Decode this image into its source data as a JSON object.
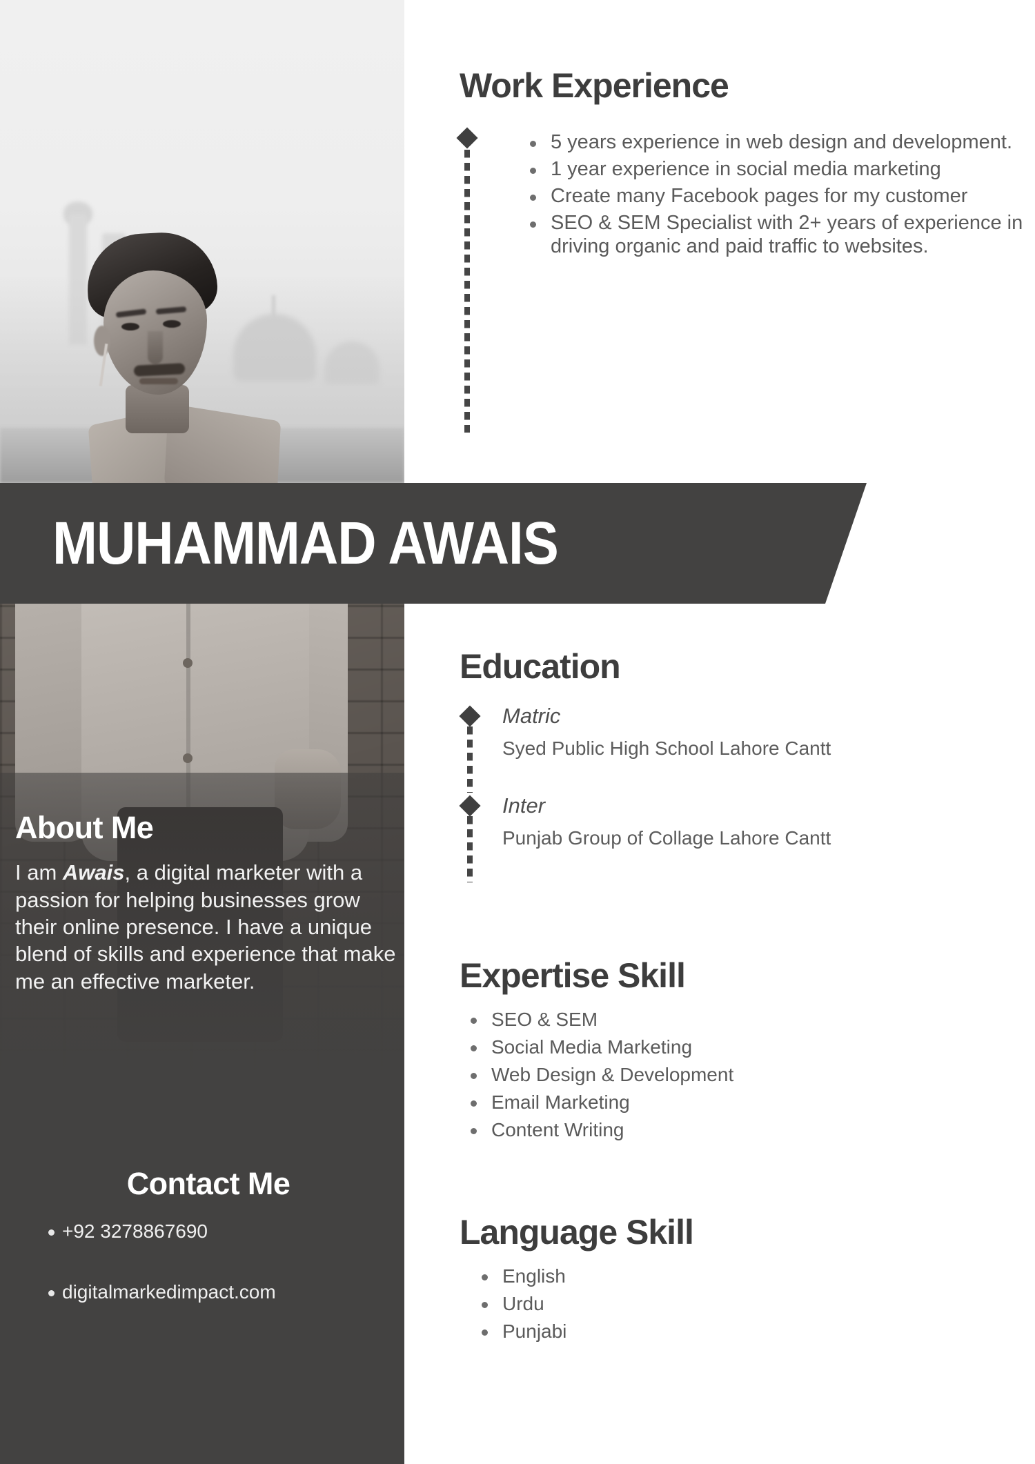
{
  "person": {
    "name": "MUHAMMAD AWAIS"
  },
  "work": {
    "title": "Work Experience",
    "bullets": [
      "5 years  experience in web design and development.",
      "1 year experience in social media marketing",
      "Create many Facebook pages for my customer",
      "SEO & SEM Specialist with 2+ years of experience in driving organic and paid traffic to websites."
    ]
  },
  "about": {
    "title": "About Me",
    "text_before": "I am ",
    "highlight": "Awais",
    "text_after": ", a digital marketer with a passion for helping businesses grow their online presence. I have a unique blend of skills and experience that make me an effective marketer."
  },
  "contact": {
    "title": "Contact Me",
    "items": [
      "+92 3278867690",
      "digitalmarkedimpact.com"
    ]
  },
  "education": {
    "title": "Education",
    "items": [
      {
        "degree": "Matric",
        "institution": "Syed Public High School Lahore Cantt"
      },
      {
        "degree": "Inter",
        "institution": "Punjab Group of Collage Lahore Cantt"
      }
    ]
  },
  "expertise": {
    "title": "Expertise Skill",
    "items": [
      "SEO & SEM",
      "Social Media Marketing",
      "Web Design & Development",
      "Email Marketing",
      "Content Writing"
    ]
  },
  "language": {
    "title": "Language Skill",
    "items": [
      "English",
      "Urdu",
      "Punjabi"
    ]
  },
  "colors": {
    "dark": "#434241",
    "heading": "#3d3d3d",
    "body": "#5a5a5a",
    "white": "#ffffff"
  }
}
